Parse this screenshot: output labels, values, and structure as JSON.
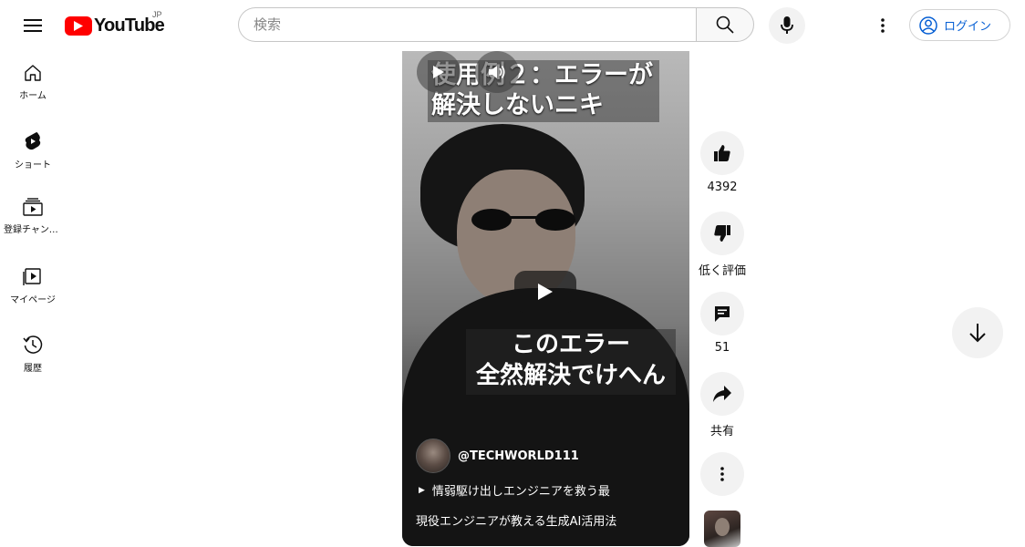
{
  "header": {
    "logo_text": "YouTube",
    "region": "JP",
    "search_placeholder": "検索",
    "login_label": "ログイン"
  },
  "sidebar": {
    "items": [
      {
        "label": "ホーム",
        "icon": "home-icon"
      },
      {
        "label": "ショート",
        "icon": "shorts-icon"
      },
      {
        "label": "登録チャンネル",
        "icon": "subscriptions-icon"
      },
      {
        "label": "マイページ",
        "icon": "library-icon"
      },
      {
        "label": "履歴",
        "icon": "history-icon"
      }
    ]
  },
  "video": {
    "caption_top": [
      "使用例２：エラーが",
      "解決しないニキ"
    ],
    "caption_mid": [
      "このエラー",
      "全然解決でけへん"
    ],
    "channel_handle": "@TECHWORLD111",
    "short_title": "情弱駆け出しエンジニアを救う最",
    "playlist_title": "現役エンジニアが教える生成AI活用法"
  },
  "actions": {
    "like_count": "4392",
    "dislike_label": "低く評価",
    "comment_count": "51",
    "share_label": "共有"
  },
  "colors": {
    "brand_red": "#ff0000",
    "link_blue": "#065fd4"
  }
}
